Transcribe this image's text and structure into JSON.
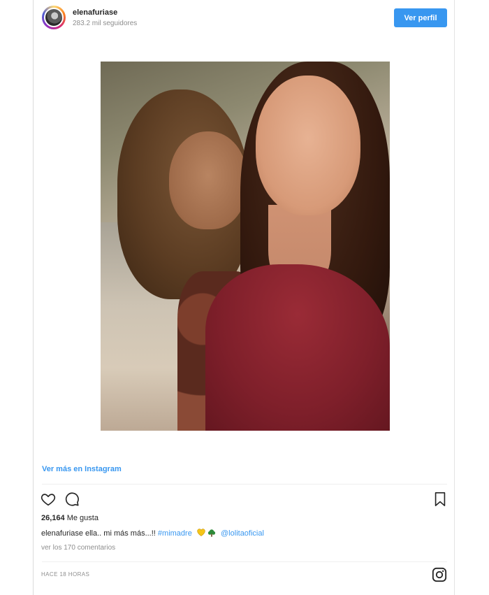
{
  "header": {
    "username": "elenafuriase",
    "followers": "283.2 mil seguidores",
    "profile_button": "Ver perfil"
  },
  "post": {
    "photo_alt": "",
    "more_link": "Ver más en Instagram",
    "likes_count": "26,164",
    "likes_label": "Me gusta",
    "caption": {
      "user": "elenafuriase",
      "text": "ella.. mi más más...!!",
      "hashtag": "#mimadre",
      "mention": "@lolitaoficial"
    },
    "comments_link": "ver los 170 comentarios",
    "time_ago": "HACE 18 HORAS"
  },
  "icons": {
    "like": "heart-icon",
    "comment": "comment-icon",
    "save": "bookmark-icon",
    "brand": "instagram-icon",
    "emoji1": "yellow-heart-emoji",
    "emoji2": "tree-emoji"
  },
  "colors": {
    "accent": "#3897f0",
    "text": "#262626",
    "muted": "#8e8e8e"
  }
}
